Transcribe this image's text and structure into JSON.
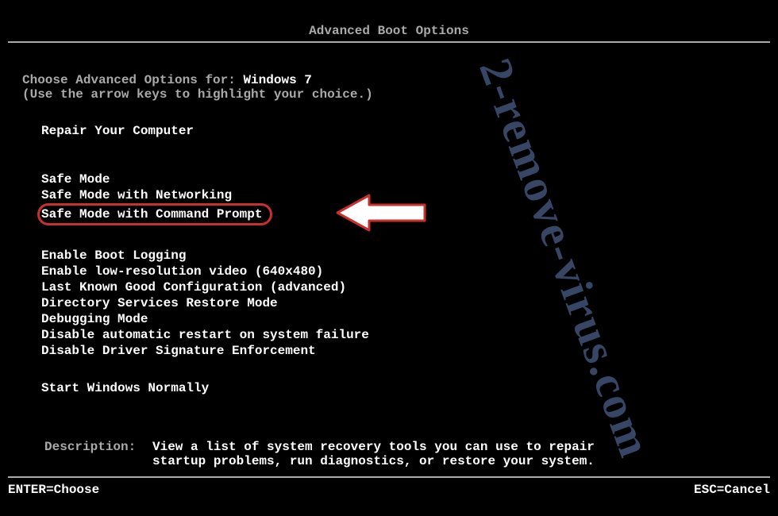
{
  "title": "Advanced Boot Options",
  "choose_prefix": "Choose Advanced Options for: ",
  "os_name": "Windows 7",
  "hint": "(Use the arrow keys to highlight your choice.)",
  "repair": "Repair Your Computer",
  "safe_modes": {
    "a": "Safe Mode",
    "b": "Safe Mode with Networking",
    "c": "Safe Mode with Command Prompt"
  },
  "options": {
    "a": "Enable Boot Logging",
    "b": "Enable low-resolution video (640x480)",
    "c": "Last Known Good Configuration (advanced)",
    "d": "Directory Services Restore Mode",
    "e": "Debugging Mode",
    "f": "Disable automatic restart on system failure",
    "g": "Disable Driver Signature Enforcement"
  },
  "start_normal": "Start Windows Normally",
  "description_label": "Description:",
  "description_text1": "View a list of system recovery tools you can use to repair",
  "description_text2": "startup problems, run diagnostics, or restore your system.",
  "footer_left": "ENTER=Choose",
  "footer_right": "ESC=Cancel",
  "watermark": "2-remove-virus.com",
  "annotation": {
    "highlight_color": "#c9302c"
  }
}
